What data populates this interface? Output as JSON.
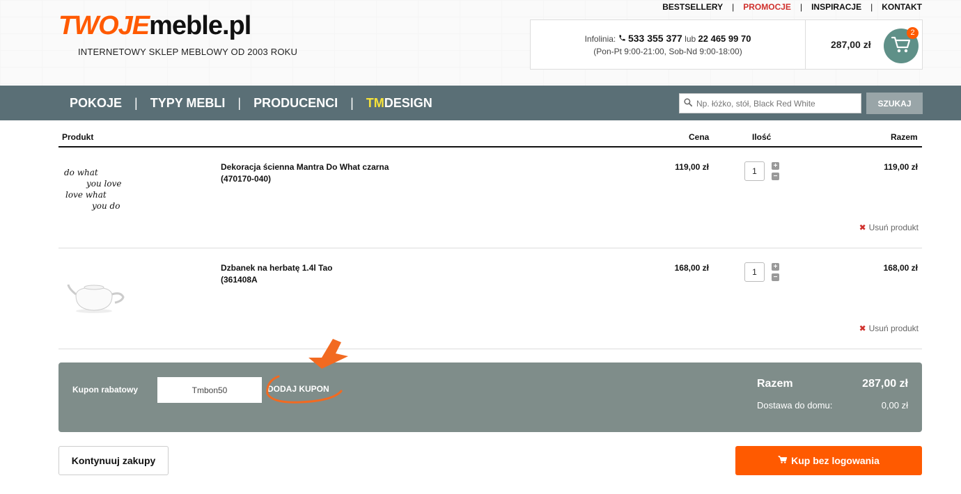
{
  "header": {
    "logo_part1": "TWOJE",
    "logo_part2": "meble.pl",
    "tagline": "INTERNETOWY SKLEP MEBLOWY OD 2003 ROKU",
    "topnav": [
      {
        "label": "BESTSELLERY"
      },
      {
        "label": "PROMOCJE"
      },
      {
        "label": "INSPIRACJE"
      },
      {
        "label": "KONTAKT"
      }
    ],
    "infolinia_label": "Infolinia:",
    "phone1": "533 355 377",
    "or_word": "lub",
    "phone2": "22 465 99 70",
    "hours": "(Pon-Pt 9:00-21:00, Sob-Nd 9:00-18:00)",
    "cart_total": "287,00 zł",
    "cart_count": "2"
  },
  "mainnav": {
    "items": [
      {
        "label": "POKOJE"
      },
      {
        "label": "TYPY MEBLI"
      },
      {
        "label": "PRODUCENCI"
      }
    ],
    "tm_prefix": "TM",
    "tm_suffix": "DESIGN",
    "search_placeholder": "Np. łóżko, stół, Black Red White",
    "search_button": "SZUKAJ"
  },
  "table": {
    "headers": {
      "product": "Produkt",
      "price": "Cena",
      "qty": "Ilość",
      "total": "Razem"
    },
    "rows": [
      {
        "name": "Dekoracja ścienna Mantra Do What czarna",
        "code": "(470170-040)",
        "price": "119,00 zł",
        "qty": "1",
        "total": "119,00 zł",
        "remove": "Usuń produkt",
        "image_lines": [
          "do what",
          "you love",
          "love what",
          "you do"
        ]
      },
      {
        "name": "Dzbanek na herbatę 1.4l Tao",
        "code": "(361408A",
        "price": "168,00 zł",
        "qty": "1",
        "total": "168,00 zł",
        "remove": "Usuń produkt"
      }
    ]
  },
  "coupon": {
    "label": "Kupon rabatowy",
    "value": "Tmbon50",
    "button": "DODAJ KUPON"
  },
  "summary": {
    "total_label": "Razem",
    "total_value": "287,00 zł",
    "shipping_label": "Dostawa do domu:",
    "shipping_value": "0,00 zł"
  },
  "actions": {
    "continue": "Kontynuuj zakupy",
    "buy": "Kup bez logowania"
  },
  "colors": {
    "accent": "#ff5a00",
    "nav": "#5a6f76",
    "panel": "#7f8d8a",
    "tm_highlight": "#f6e23a"
  }
}
